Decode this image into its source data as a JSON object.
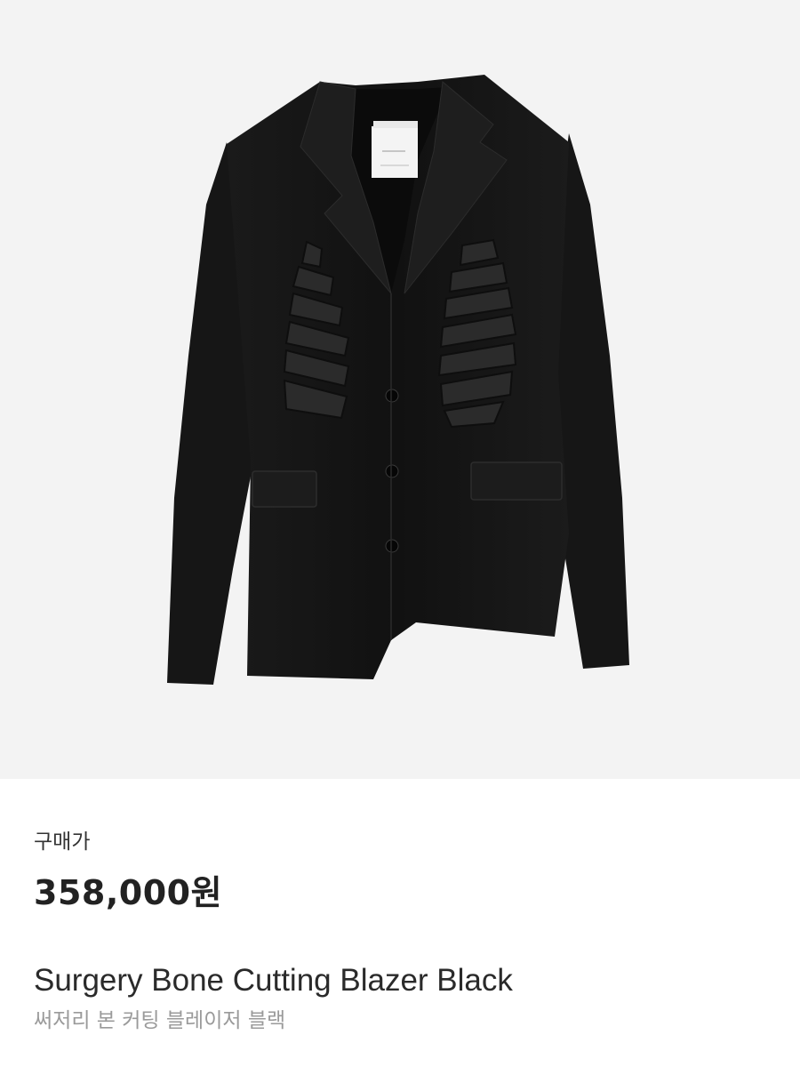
{
  "product": {
    "image_alt_icon": "blazer-photo",
    "price_label": "구매가",
    "price": "358,000원",
    "name_en": "Surgery Bone Cutting Blazer Black",
    "name_ko": "써저리 본 커팅 블레이저 블랙"
  },
  "colors": {
    "hero_background": "#f3f3f3",
    "garment": "#141414",
    "price_text": "#222222",
    "subtitle_text": "#9a9a9a"
  }
}
